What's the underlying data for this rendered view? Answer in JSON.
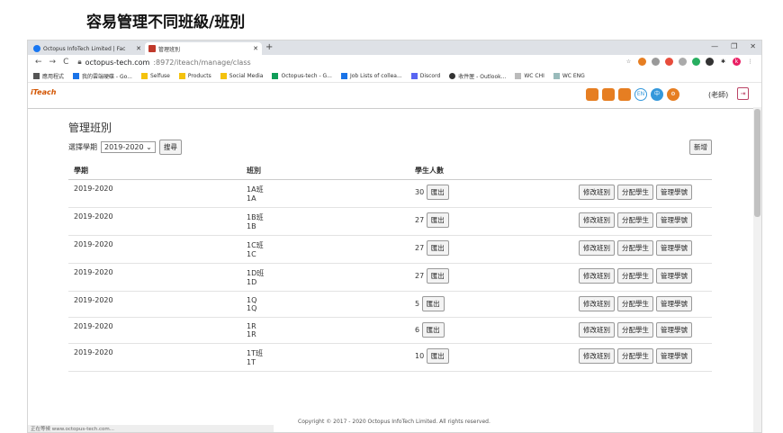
{
  "caption": "容易管理不同班級/班別",
  "browser": {
    "tabs": [
      {
        "label": "Octopus InfoTech Limited | Fac",
        "active": false
      },
      {
        "label": "管理班別",
        "active": true
      }
    ],
    "new_tab": "+",
    "window_controls": [
      "—",
      "❐",
      "✕"
    ],
    "nav": {
      "back": "←",
      "forward": "→",
      "reload": "C"
    },
    "url_host": "octopus-tech.com",
    "url_path": ":8972/iteach/manage/class",
    "bookmarks": [
      {
        "label": "應用程式",
        "color": "#555"
      },
      {
        "label": "我的雲端硬碟 - Go...",
        "color": "#1a73e8"
      },
      {
        "label": "Selfuse",
        "color": "#f4c20d"
      },
      {
        "label": "Products",
        "color": "#f4c20d"
      },
      {
        "label": "Social Media",
        "color": "#f4c20d"
      },
      {
        "label": "Octopus-tech - G...",
        "color": "#0f9d58"
      },
      {
        "label": "Job Lists of collea...",
        "color": "#1a73e8"
      },
      {
        "label": "Discord",
        "color": "#5865f2"
      },
      {
        "label": "收件匣 - Outlook...",
        "color": "#333"
      },
      {
        "label": "WC CHI",
        "color": "#888"
      },
      {
        "label": "WC ENG",
        "color": "#888"
      }
    ]
  },
  "app": {
    "logo": "iTeach",
    "teacher_label": "(老師)",
    "page_title": "管理班別",
    "filter_label": "選擇學期",
    "term_selected": "2019-2020 ⌄",
    "search_button": "搜尋",
    "add_button": "新增",
    "columns": [
      "學期",
      "班別",
      "學生人數"
    ],
    "export_label": "匯出",
    "actions": [
      "修改班別",
      "分配學生",
      "管理學號"
    ],
    "rows": [
      {
        "term": "2019-2020",
        "class_name": "1A班",
        "class_code": "1A",
        "students": "30"
      },
      {
        "term": "2019-2020",
        "class_name": "1B班",
        "class_code": "1B",
        "students": "27"
      },
      {
        "term": "2019-2020",
        "class_name": "1C班",
        "class_code": "1C",
        "students": "27"
      },
      {
        "term": "2019-2020",
        "class_name": "1D班",
        "class_code": "1D",
        "students": "27"
      },
      {
        "term": "2019-2020",
        "class_name": "1Q",
        "class_code": "1Q",
        "students": "5"
      },
      {
        "term": "2019-2020",
        "class_name": "1R",
        "class_code": "1R",
        "students": "6"
      },
      {
        "term": "2019-2020",
        "class_name": "1T班",
        "class_code": "1T",
        "students": "10"
      }
    ],
    "footer": "Copyright © 2017 - 2020 Octopus InfoTech Limited. All rights reserved.",
    "status_bar": "正在等候 www.octopus-tech.com..."
  }
}
